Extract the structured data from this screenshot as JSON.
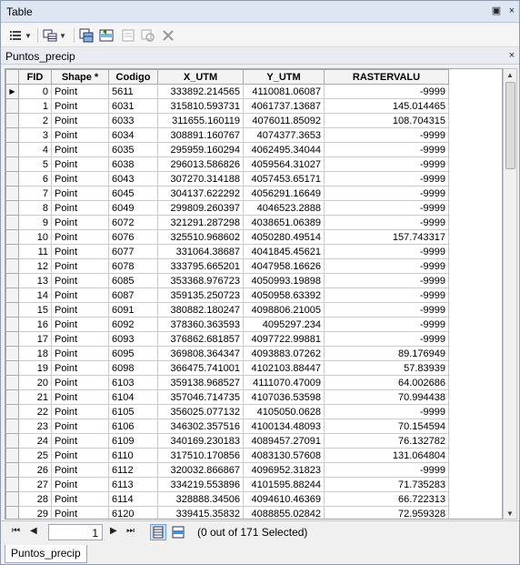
{
  "window": {
    "title": "Table",
    "pin_glyph": "▣",
    "close_glyph": "×"
  },
  "toolbar": {
    "items": [
      {
        "name": "table-options-icon",
        "has_dropdown": true
      },
      {
        "name": "related-tables-icon",
        "has_dropdown": true
      },
      {
        "name": "select-by-attributes-icon",
        "has_dropdown": false
      },
      {
        "name": "switch-selection-icon",
        "has_dropdown": false
      },
      {
        "name": "clear-selection-icon",
        "has_dropdown": false
      },
      {
        "name": "zoom-to-selected-icon",
        "has_dropdown": false
      },
      {
        "name": "delete-selected-icon",
        "has_dropdown": false
      }
    ]
  },
  "table_tab": {
    "name": "Puntos_precip",
    "close_glyph": "×"
  },
  "grid": {
    "columns": [
      "FID",
      "Shape *",
      "Codigo",
      "X_UTM",
      "Y_UTM",
      "RASTERVALU"
    ],
    "rows": [
      [
        "0",
        "Point",
        "5611",
        "333892.214565",
        "4110081.06087",
        "-9999"
      ],
      [
        "1",
        "Point",
        "6031",
        "315810.593731",
        "4061737.13687",
        "145.014465"
      ],
      [
        "2",
        "Point",
        "6033",
        "311655.160119",
        "4076011.85092",
        "108.704315"
      ],
      [
        "3",
        "Point",
        "6034",
        "308891.160767",
        "4074377.3653",
        "-9999"
      ],
      [
        "4",
        "Point",
        "6035",
        "295959.160294",
        "4062495.34044",
        "-9999"
      ],
      [
        "5",
        "Point",
        "6038",
        "296013.586826",
        "4059564.31027",
        "-9999"
      ],
      [
        "6",
        "Point",
        "6043",
        "307270.314188",
        "4057453.65171",
        "-9999"
      ],
      [
        "7",
        "Point",
        "6045",
        "304137.622292",
        "4056291.16649",
        "-9999"
      ],
      [
        "8",
        "Point",
        "6049",
        "299809.260397",
        "4046523.2888",
        "-9999"
      ],
      [
        "9",
        "Point",
        "6072",
        "321291.287298",
        "4038651.06389",
        "-9999"
      ],
      [
        "10",
        "Point",
        "6076",
        "325510.968602",
        "4050280.49514",
        "157.743317"
      ],
      [
        "11",
        "Point",
        "6077",
        "331064.38687",
        "4041845.45621",
        "-9999"
      ],
      [
        "12",
        "Point",
        "6078",
        "333795.665201",
        "4047958.16626",
        "-9999"
      ],
      [
        "13",
        "Point",
        "6085",
        "353368.976723",
        "4050993.19898",
        "-9999"
      ],
      [
        "14",
        "Point",
        "6087",
        "359135.250723",
        "4050958.63392",
        "-9999"
      ],
      [
        "15",
        "Point",
        "6091",
        "380882.180247",
        "4098806.21005",
        "-9999"
      ],
      [
        "16",
        "Point",
        "6092",
        "378360.363593",
        "4095297.234",
        "-9999"
      ],
      [
        "17",
        "Point",
        "6093",
        "376862.681857",
        "4097722.99881",
        "-9999"
      ],
      [
        "18",
        "Point",
        "6095",
        "369808.364347",
        "4093883.07262",
        "89.176949"
      ],
      [
        "19",
        "Point",
        "6098",
        "366475.741001",
        "4102103.88447",
        "57.83939"
      ],
      [
        "20",
        "Point",
        "6103",
        "359138.968527",
        "4111070.47009",
        "64.002686"
      ],
      [
        "21",
        "Point",
        "6104",
        "357046.714735",
        "4107036.53598",
        "70.994438"
      ],
      [
        "22",
        "Point",
        "6105",
        "356025.077132",
        "4105050.0628",
        "-9999"
      ],
      [
        "23",
        "Point",
        "6106",
        "346302.357516",
        "4100134.48093",
        "70.154594"
      ],
      [
        "24",
        "Point",
        "6109",
        "340169.230183",
        "4089457.27091",
        "76.132782"
      ],
      [
        "25",
        "Point",
        "6110",
        "317510.170856",
        "4083130.57608",
        "131.064804"
      ],
      [
        "26",
        "Point",
        "6112",
        "320032.866867",
        "4096952.31823",
        "-9999"
      ],
      [
        "27",
        "Point",
        "6113",
        "334219.553896",
        "4101595.88244",
        "71.735283"
      ],
      [
        "28",
        "Point",
        "6114",
        "328888.34506",
        "4094610.46369",
        "66.722313"
      ],
      [
        "29",
        "Point",
        "6120",
        "339415.35832",
        "4088855.02842",
        "72.959328"
      ]
    ],
    "current_row_marker": "▶"
  },
  "footer": {
    "first_glyph": "⏮",
    "prev_glyph": "◀",
    "next_glyph": "▶",
    "last_glyph": "⏭",
    "current_record": "1",
    "status": "(0 out of 171 Selected)"
  },
  "bottom_tab": {
    "label": "Puntos_precip"
  },
  "colors": {
    "titlebar": "#dde6f2",
    "selected_view": "#cfe3f7"
  }
}
